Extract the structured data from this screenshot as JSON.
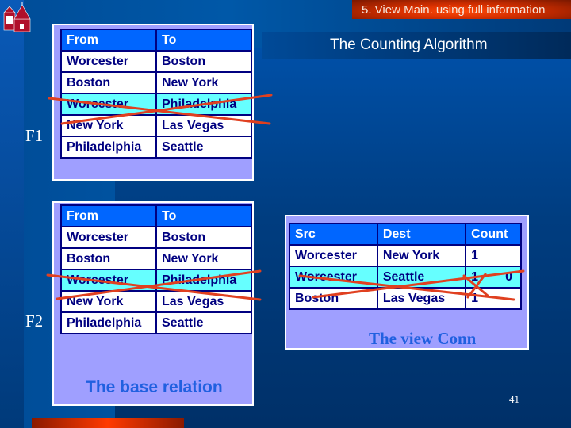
{
  "header": {
    "section_title": "5. View Main. using full information"
  },
  "slide": {
    "title": "The Counting Algorithm",
    "page_number": "41"
  },
  "colors": {
    "accent_red": "#d83000",
    "header_cell": "#0066ff",
    "highlight_row": "#66ffff",
    "text_navy": "#000080",
    "strike": "#e04020"
  },
  "f1": {
    "label": "F1",
    "columns": [
      "From",
      "To"
    ],
    "rows": [
      [
        "Worcester",
        "Boston"
      ],
      [
        "Boston",
        "New York"
      ],
      [
        "Worcester",
        "Philadelphia"
      ],
      [
        "New York",
        "Las Vegas"
      ],
      [
        "Philadelphia",
        "Seattle"
      ]
    ],
    "struck_row": 2
  },
  "f2": {
    "label": "F2",
    "columns": [
      "From",
      "To"
    ],
    "rows": [
      [
        "Worcester",
        "Boston"
      ],
      [
        "Boston",
        "New York"
      ],
      [
        "Worcester",
        "Philadelphia"
      ],
      [
        "New York",
        "Las Vegas"
      ],
      [
        "Philadelphia",
        "Seattle"
      ]
    ],
    "struck_row": 2,
    "caption": "The base relation"
  },
  "conn": {
    "columns": [
      "Src",
      "Dest",
      "Count"
    ],
    "rows": [
      [
        "Worcester",
        "New York",
        "1"
      ],
      [
        "Worcester",
        "Seattle",
        "1"
      ],
      [
        "Boston",
        "Las Vegas",
        "1"
      ]
    ],
    "struck_row": 1,
    "struck_count_new_value": "0",
    "caption": "The view Conn"
  }
}
